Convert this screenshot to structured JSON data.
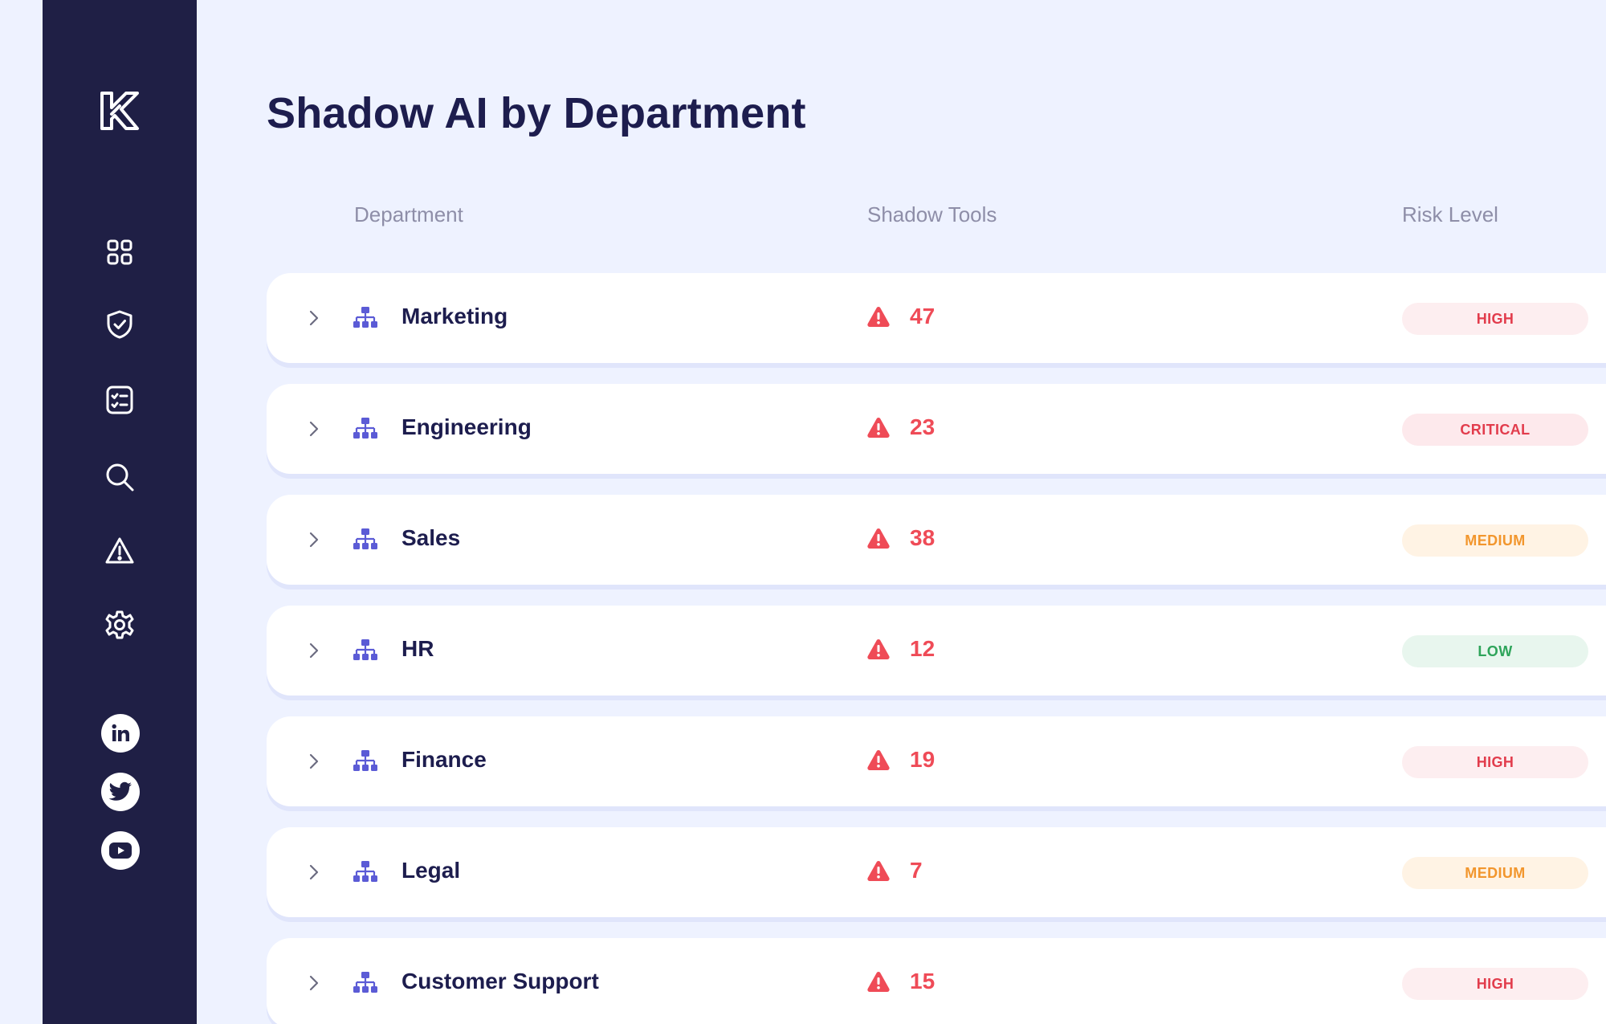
{
  "app": {
    "logo_letter": "K"
  },
  "sidebar": {
    "nav": [
      {
        "icon": "grid-icon"
      },
      {
        "icon": "shield-check-icon"
      },
      {
        "icon": "checklist-icon"
      },
      {
        "icon": "search-icon"
      },
      {
        "icon": "alert-triangle-icon"
      },
      {
        "icon": "gear-icon"
      }
    ],
    "social": [
      {
        "icon": "linkedin-icon"
      },
      {
        "icon": "twitter-icon"
      },
      {
        "icon": "youtube-icon"
      }
    ],
    "background": "#1f1f45"
  },
  "page": {
    "title": "Shadow AI by Department"
  },
  "table": {
    "headers": {
      "department": "Department",
      "shadow_tools": "Shadow Tools",
      "risk_level": "Risk Level"
    },
    "rows": [
      {
        "department": "Marketing",
        "shadow_tools": "47",
        "risk": "HIGH"
      },
      {
        "department": "Engineering",
        "shadow_tools": "23",
        "risk": "CRITICAL"
      },
      {
        "department": "Sales",
        "shadow_tools": "38",
        "risk": "MEDIUM"
      },
      {
        "department": "HR",
        "shadow_tools": "12",
        "risk": "LOW"
      },
      {
        "department": "Finance",
        "shadow_tools": "19",
        "risk": "HIGH"
      },
      {
        "department": "Legal",
        "shadow_tools": "7",
        "risk": "MEDIUM"
      },
      {
        "department": "Customer Support",
        "shadow_tools": "15",
        "risk": "HIGH"
      }
    ]
  },
  "colors": {
    "accent": "#5b5bd6",
    "danger": "#ef4b57",
    "high_bg": "#fdeef0",
    "medium_text": "#f2962d",
    "low_text": "#2ea45a"
  }
}
